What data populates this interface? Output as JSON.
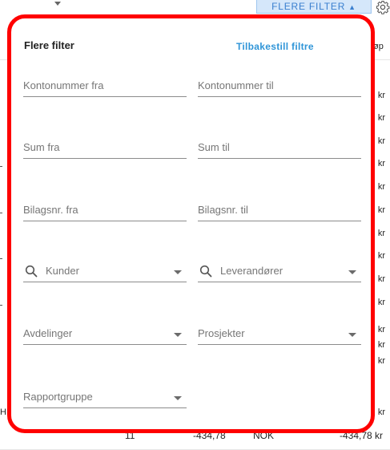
{
  "toolbar": {
    "flere_filter_label": "FLERE FILTER",
    "flere_filter_chevron": "^",
    "settings_icon": "gear-icon"
  },
  "background": {
    "column_header_partial": "øp",
    "currency_suffix": "kr",
    "left_edge_text": "HF",
    "bottom_row": {
      "count": "11",
      "amount": "-434,78",
      "currency": "NOK",
      "amount_kr": "-434,78 kr"
    }
  },
  "panel": {
    "title": "Flere filter",
    "reset_label": "Tilbakestill filtre",
    "fields": {
      "account_from": "Kontonummer fra",
      "account_to": "Kontonummer til",
      "sum_from": "Sum fra",
      "sum_to": "Sum til",
      "voucher_from": "Bilagsnr. fra",
      "voucher_to": "Bilagsnr. til",
      "customers": "Kunder",
      "suppliers": "Leverandører",
      "departments": "Avdelinger",
      "projects": "Prosjekter",
      "report_group": "Rapportgruppe"
    }
  },
  "colors": {
    "highlight_border": "#ff0000",
    "link": "#2f95d8",
    "button_bg": "#d5e7fa"
  }
}
